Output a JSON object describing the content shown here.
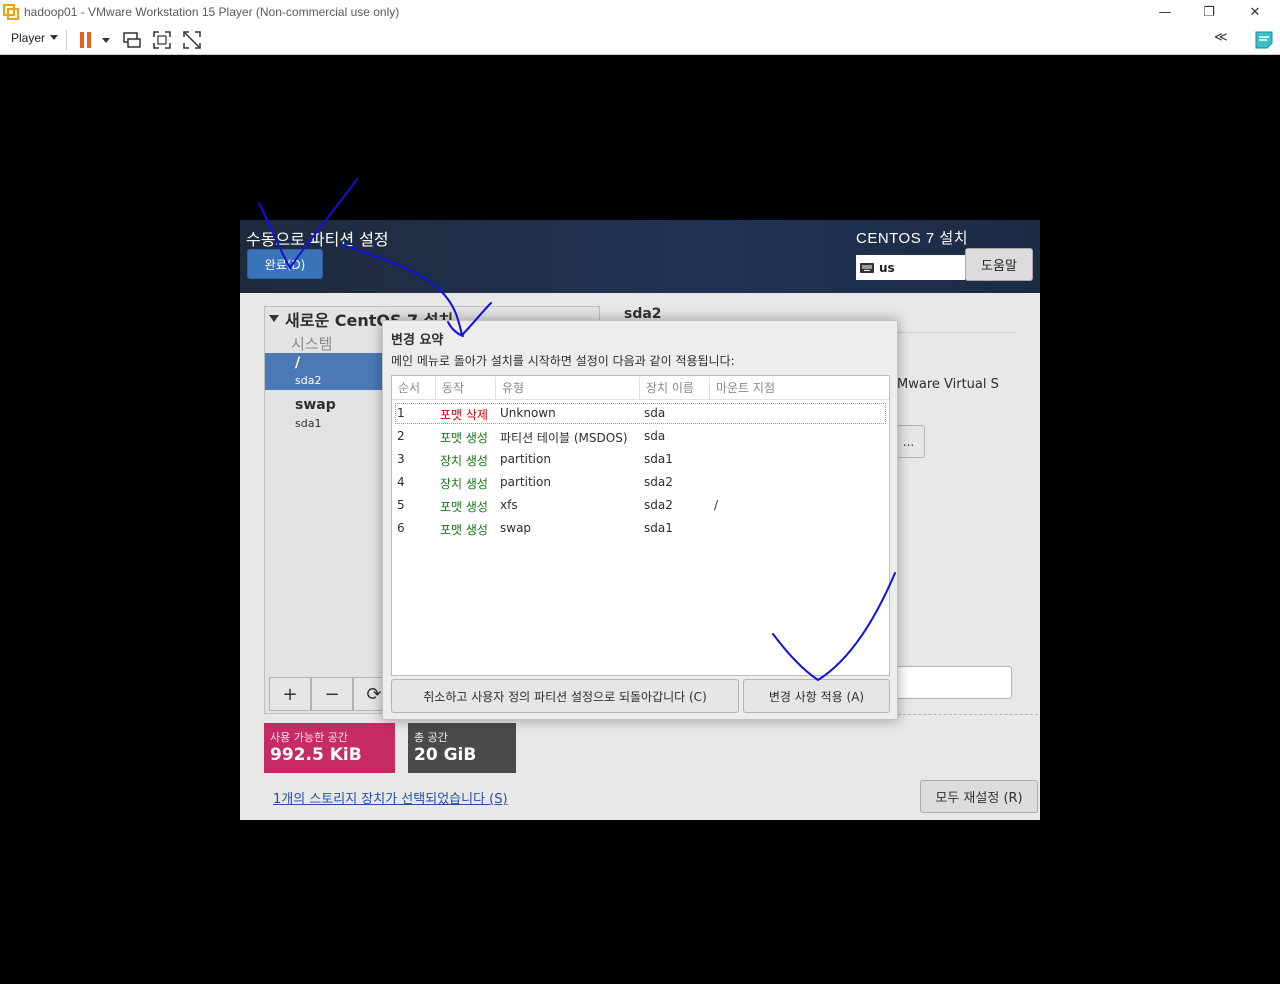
{
  "window": {
    "title": "hadoop01 - VMware Workstation 15 Player (Non-commercial use only)",
    "minimize": "—",
    "restore": "❐",
    "close": "✕"
  },
  "toolbar": {
    "player_label": "Player",
    "collapse_label": "≪"
  },
  "installer": {
    "page_title": "수동으로 파티션 설정",
    "done_button": "완료(D)",
    "product_title": "CENTOS 7 설치",
    "keyboard_layout": "us",
    "help_button": "도움말",
    "tree_title": "새로운 CentOS 7 설치",
    "tree_group": "시스템",
    "partitions": [
      {
        "name": "/",
        "device": "sda2"
      },
      {
        "name": "swap",
        "device": "sda1"
      }
    ],
    "panel_buttons": {
      "add": "+",
      "remove": "−",
      "refresh": "⟳"
    },
    "available_space": {
      "label": "사용 가능한 공간",
      "value": "992.5 KiB"
    },
    "total_space": {
      "label": "총 공간",
      "value": "20 GiB"
    },
    "storage_link": "1개의 스토리지 장치가 선택되었습니다 (S)",
    "reset_button": "모두 재설정 (R)",
    "detail_title": "sda2",
    "detail_device": "Mware Virtual S",
    "detail_button": "..."
  },
  "dialog": {
    "title": "변경 요약",
    "subtitle": "메인 메뉴로 돌아가 설치를 시작하면 설정이 다음과 같이 적용됩니다:",
    "columns": [
      "순서",
      "동작",
      "유형",
      "장치 이름",
      "마운트 지점"
    ],
    "rows": [
      {
        "order": "1",
        "action": "포맷 삭제",
        "type": "Unknown",
        "device": "sda",
        "mount": ""
      },
      {
        "order": "2",
        "action": "포맷 생성",
        "type": "파티션 테이블 (MSDOS)",
        "device": "sda",
        "mount": ""
      },
      {
        "order": "3",
        "action": "장치 생성",
        "type": "partition",
        "device": "sda1",
        "mount": ""
      },
      {
        "order": "4",
        "action": "장치 생성",
        "type": "partition",
        "device": "sda2",
        "mount": ""
      },
      {
        "order": "5",
        "action": "포맷 생성",
        "type": "xfs",
        "device": "sda2",
        "mount": "/"
      },
      {
        "order": "6",
        "action": "포맷 생성",
        "type": "swap",
        "device": "sda1",
        "mount": ""
      }
    ],
    "cancel_button": "취소하고 사용자 정의 파티션 설정으로 되돌아갑니다 (C)",
    "accept_button": "변경 사항 적용 (A)"
  },
  "colors": {
    "delete_action": "#cc0000",
    "create_action": "#1a7a1a",
    "annotation_ink": "#1010e0",
    "available_box": "#c62b66",
    "total_box": "#4a4a4a"
  }
}
